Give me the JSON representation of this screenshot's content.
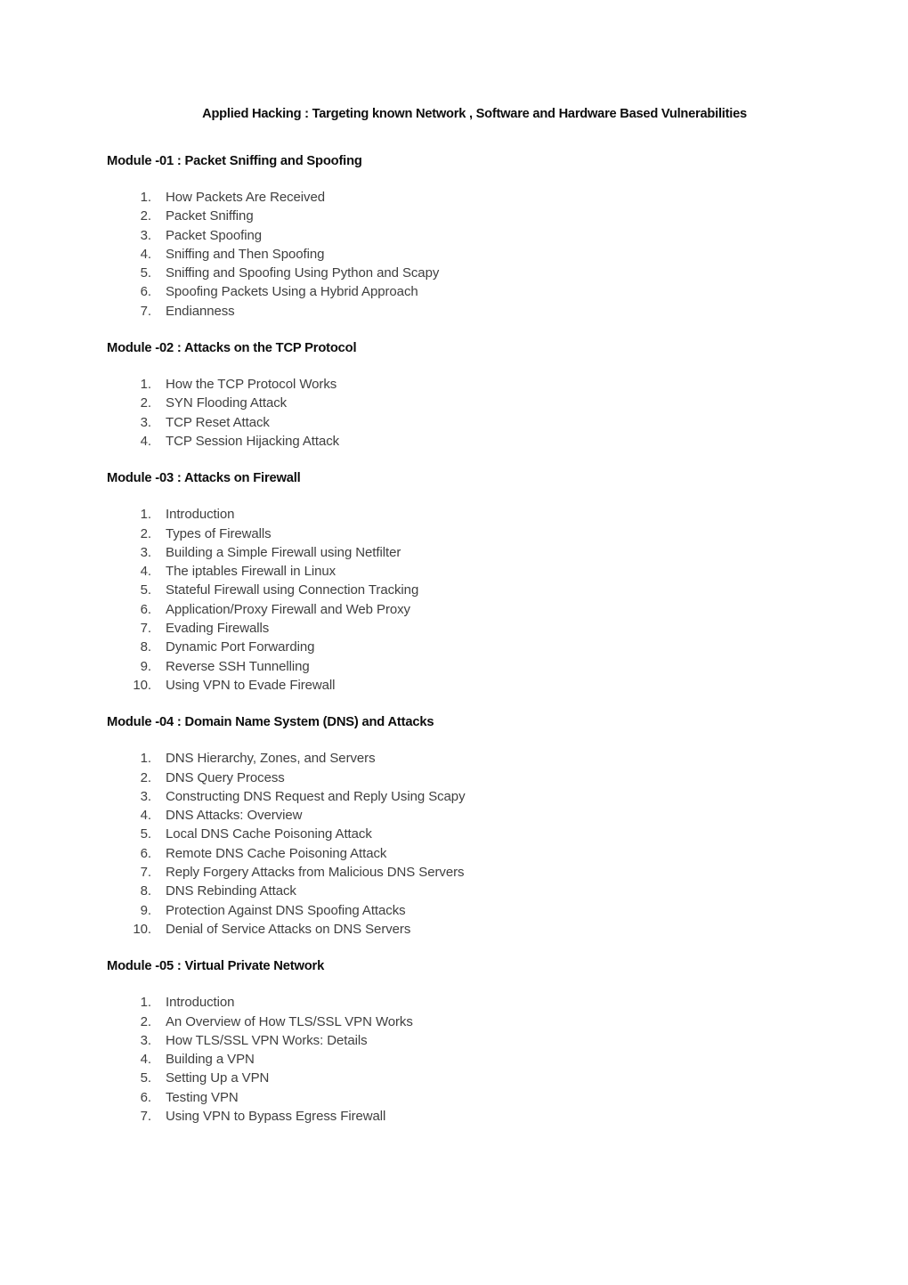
{
  "document": {
    "title": "Applied Hacking : Targeting known Network , Software and Hardware Based Vulnerabilities",
    "text_color": "#3f3f3f",
    "heading_color": "#0d0d0d",
    "background_color": "#ffffff"
  },
  "modules": [
    {
      "heading": "Module -01 : Packet Sniffing and Spoofing",
      "items": [
        "How Packets Are Received",
        "Packet Sniffing",
        "Packet Spoofing",
        "Sniffing and Then Spoofing",
        "Sniffing and Spoofing Using Python and Scapy",
        "Spoofing Packets Using a Hybrid Approach",
        "Endianness"
      ]
    },
    {
      "heading": "Module -02 : Attacks on the TCP Protocol",
      "items": [
        "How the TCP Protocol Works",
        "SYN Flooding Attack",
        "TCP Reset Attack",
        "TCP Session Hijacking Attack"
      ]
    },
    {
      "heading": "Module -03 : Attacks on Firewall",
      "items": [
        "Introduction",
        "Types of Firewalls",
        "Building a Simple Firewall using Netfilter",
        "The iptables Firewall in Linux",
        "Stateful Firewall using Connection Tracking",
        "Application/Proxy Firewall and Web Proxy",
        "Evading Firewalls",
        "Dynamic Port Forwarding",
        "Reverse SSH Tunnelling",
        "Using VPN to Evade Firewall"
      ]
    },
    {
      "heading": "Module -04 : Domain Name System (DNS) and Attacks",
      "items": [
        "DNS Hierarchy, Zones, and Servers",
        "DNS Query Process",
        "Constructing DNS Request and Reply Using Scapy",
        "DNS Attacks: Overview",
        "Local DNS Cache Poisoning Attack",
        "Remote DNS Cache Poisoning Attack",
        "Reply Forgery Attacks from Malicious DNS Servers",
        "DNS Rebinding Attack",
        "Protection Against DNS Spoofing Attacks",
        "Denial of Service Attacks on DNS Servers"
      ]
    },
    {
      "heading": "Module -05 : Virtual Private Network",
      "items": [
        "Introduction",
        "An Overview of How TLS/SSL VPN Works",
        "How TLS/SSL VPN Works: Details",
        "Building a VPN",
        "Setting Up a VPN",
        "Testing VPN",
        "Using VPN to Bypass Egress Firewall"
      ]
    }
  ]
}
